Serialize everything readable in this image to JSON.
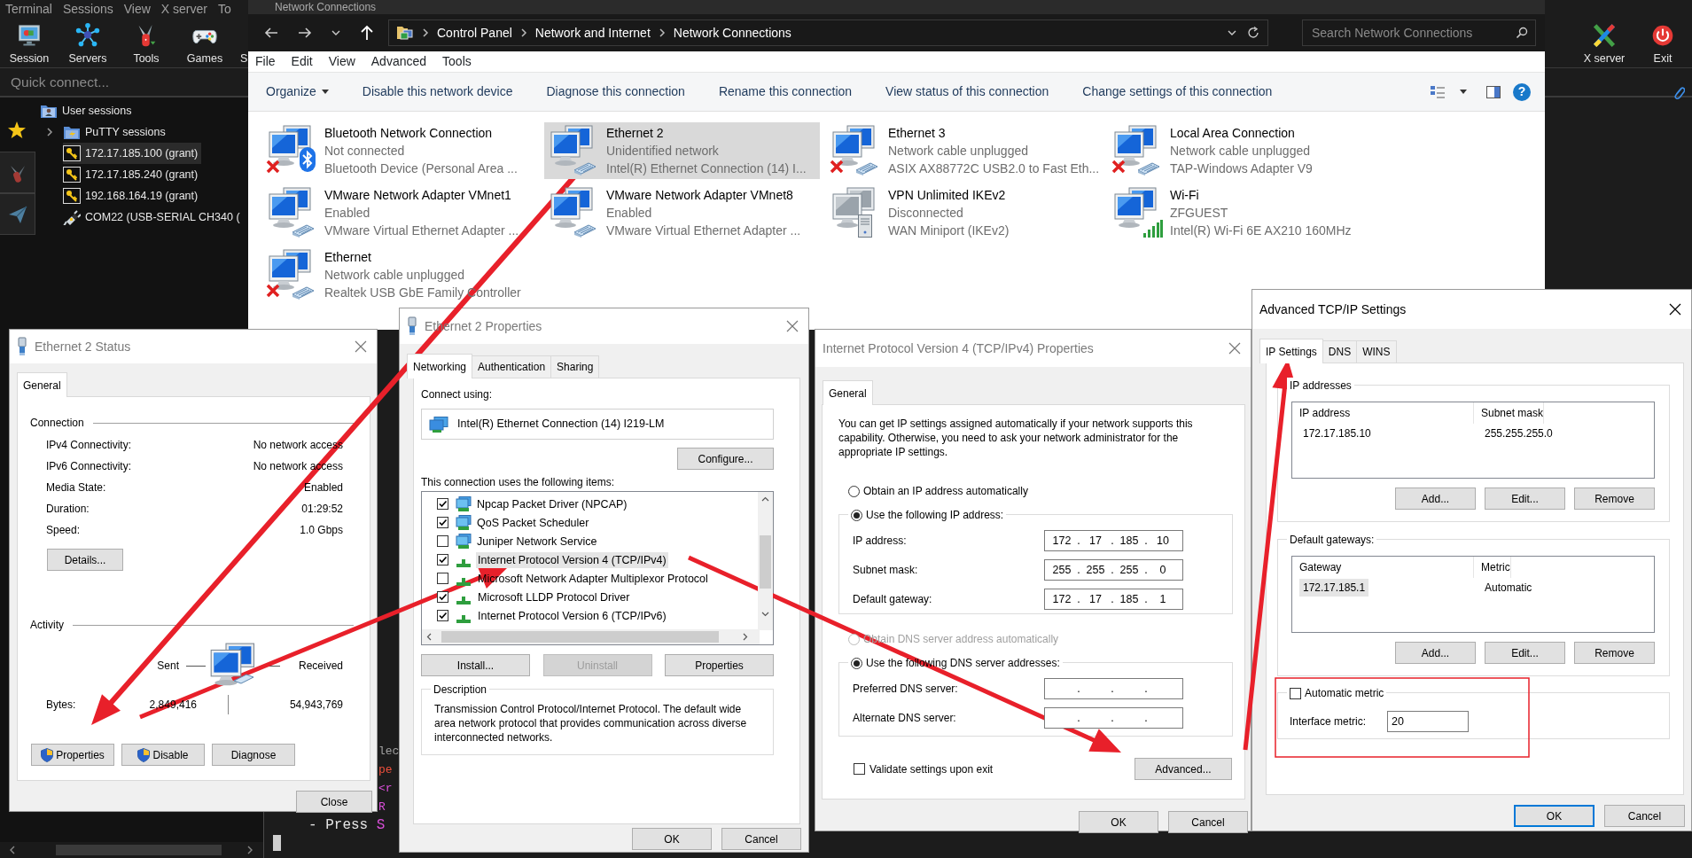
{
  "mobaxterm": {
    "menu": [
      "Terminal",
      "Sessions",
      "View",
      "X server",
      "To"
    ],
    "toolbar": [
      {
        "label": "Session",
        "kind": "session"
      },
      {
        "label": "Servers",
        "kind": "servers"
      },
      {
        "label": "Tools",
        "kind": "tools"
      },
      {
        "label": "Games",
        "kind": "games"
      },
      {
        "label": "S",
        "kind": "partial"
      }
    ],
    "toolbar_right": [
      {
        "label": "X server",
        "kind": "xserver"
      },
      {
        "label": "Exit",
        "kind": "exit"
      }
    ],
    "quick_connect": {
      "placeholder": "Quick connect..."
    },
    "side_tabs": [
      {
        "kind": "star",
        "selected": true
      },
      {
        "kind": "tools",
        "selected": false
      },
      {
        "kind": "send",
        "selected": false
      }
    ],
    "tree": [
      {
        "label": "User sessions",
        "kind": "user-folder",
        "selected": false,
        "children": [
          {
            "label": "PuTTY sessions",
            "kind": "folder",
            "expanded": false,
            "selected": false
          },
          {
            "label": "172.17.185.100 (grant)",
            "kind": "ssh",
            "selected": true
          },
          {
            "label": "172.17.185.240 (grant)",
            "kind": "ssh",
            "selected": false
          },
          {
            "label": "192.168.164.19 (grant)",
            "kind": "ssh",
            "selected": false
          },
          {
            "label": "COM22  (USB-SERIAL CH340 (",
            "kind": "serial",
            "selected": false
          }
        ]
      }
    ],
    "terminal_lines": [
      {
        "kind": "partial",
        "segments": [
          {
            "text": "lec",
            "color": "#a0a0a0"
          }
        ]
      },
      {
        "kind": "partial",
        "segments": [
          {
            "text": "pe",
            "color": "#f0503c"
          }
        ]
      },
      {
        "kind": "partial",
        "segments": [
          {
            "text": "<r",
            "color": "#d94fd9"
          }
        ]
      },
      {
        "kind": "partial",
        "segments": [
          {
            "text": "R",
            "color": "#d94fd9"
          }
        ]
      },
      {
        "kind": "full",
        "segments": [
          {
            "text": "- Press ",
            "color": "#e6e6e6"
          },
          {
            "text": "S",
            "color": "#d94fd9"
          }
        ]
      }
    ]
  },
  "explorer": {
    "title": "Network Connections",
    "breadcrumb": [
      "Control Panel",
      "Network and Internet",
      "Network Connections"
    ],
    "search": {
      "placeholder": "Search Network Connections"
    },
    "menu": [
      "File",
      "Edit",
      "View",
      "Advanced",
      "Tools"
    ],
    "commands": [
      {
        "label": "Organize",
        "kind": "dropdown"
      },
      {
        "label": "Disable this network device",
        "kind": "command"
      },
      {
        "label": "Diagnose this connection",
        "kind": "command"
      },
      {
        "label": "Rename this connection",
        "kind": "command"
      },
      {
        "label": "View status of this connection",
        "kind": "command"
      },
      {
        "label": "Change settings of this connection",
        "kind": "command"
      }
    ],
    "help": "?",
    "connections": [
      {
        "name": "Bluetooth Network Connection",
        "status": "Not connected",
        "device": "Bluetooth Device (Personal Area ...",
        "kind": "bluetooth",
        "error": true,
        "selected": false
      },
      {
        "name": "Ethernet 2",
        "status": "Unidentified network",
        "device": "Intel(R) Ethernet Connection (14) I...",
        "kind": "cable",
        "error": false,
        "selected": true
      },
      {
        "name": "Ethernet 3",
        "status": "Network cable unplugged",
        "device": "ASIX AX88772C USB2.0 to Fast Eth...",
        "kind": "cable",
        "error": true,
        "selected": false
      },
      {
        "name": "Local Area Connection",
        "status": "Network cable unplugged",
        "device": "TAP-Windows Adapter V9",
        "kind": "cable",
        "error": true,
        "selected": false
      },
      {
        "name": "VMware Network Adapter VMnet1",
        "status": "Enabled",
        "device": "VMware Virtual Ethernet Adapter ...",
        "kind": "cable",
        "error": false,
        "selected": false
      },
      {
        "name": "VMware Network Adapter VMnet8",
        "status": "Enabled",
        "device": "VMware Virtual Ethernet Adapter ...",
        "kind": "cable",
        "error": false,
        "selected": false
      },
      {
        "name": "VPN Unlimited IKEv2",
        "status": "Disconnected",
        "device": "WAN Miniport (IKEv2)",
        "kind": "vpn",
        "error": false,
        "selected": false
      },
      {
        "name": "Wi-Fi",
        "status": "ZFGUEST",
        "device": "Intel(R) Wi-Fi 6E AX210 160MHz",
        "kind": "wifi",
        "error": false,
        "selected": false
      },
      {
        "name": "Ethernet",
        "status": "Network cable unplugged",
        "device": "Realtek USB GbE Family Controller",
        "kind": "cable",
        "error": true,
        "selected": false
      }
    ]
  },
  "status_dialog": {
    "title": "Ethernet 2 Status",
    "active": false,
    "title_icon": true,
    "tabs": [
      {
        "label": "General",
        "selected": true
      }
    ],
    "connection_heading": "Connection",
    "fields": [
      {
        "label": "IPv4 Connectivity:",
        "value": "No network access"
      },
      {
        "label": "IPv6 Connectivity:",
        "value": "No network access"
      },
      {
        "label": "Media State:",
        "value": "Enabled"
      },
      {
        "label": "Duration:",
        "value": "01:29:52"
      },
      {
        "label": "Speed:",
        "value": "1.0 Gbps"
      }
    ],
    "details_button": "Details...",
    "activity_heading": "Activity",
    "sent_label": "Sent",
    "received_label": "Received",
    "bytes_label": "Bytes:",
    "bytes_sent": "2,849,416",
    "bytes_received": "54,943,769",
    "buttons": [
      {
        "label": "Properties",
        "shield": true
      },
      {
        "label": "Disable",
        "shield": true
      },
      {
        "label": "Diagnose",
        "shield": false
      }
    ],
    "close_button": "Close"
  },
  "properties_dialog": {
    "title": "Ethernet 2 Properties",
    "active": false,
    "title_icon": true,
    "tabs": [
      {
        "label": "Networking",
        "selected": true
      },
      {
        "label": "Authentication",
        "selected": false
      },
      {
        "label": "Sharing",
        "selected": false
      }
    ],
    "connect_using_label": "Connect using:",
    "adapter": "Intel(R) Ethernet Connection (14) I219-LM",
    "configure_button": "Configure...",
    "items_label": "This connection uses the following items:",
    "items": [
      {
        "label": "Npcap Packet Driver (NPCAP)",
        "checked": true,
        "kind": "service",
        "selected": false
      },
      {
        "label": "QoS Packet Scheduler",
        "checked": true,
        "kind": "service",
        "selected": false
      },
      {
        "label": "Juniper Network Service",
        "checked": false,
        "kind": "service",
        "selected": false
      },
      {
        "label": "Internet Protocol Version 4 (TCP/IPv4)",
        "checked": true,
        "kind": "protocol",
        "selected": true
      },
      {
        "label": "Microsoft Network Adapter Multiplexor Protocol",
        "checked": false,
        "kind": "protocol",
        "selected": false
      },
      {
        "label": "Microsoft LLDP Protocol Driver",
        "checked": true,
        "kind": "protocol",
        "selected": false
      },
      {
        "label": "Internet Protocol Version 6 (TCP/IPv6)",
        "checked": true,
        "kind": "protocol",
        "selected": false
      }
    ],
    "buttons": [
      {
        "label": "Install...",
        "disabled": false
      },
      {
        "label": "Uninstall",
        "disabled": true
      },
      {
        "label": "Properties",
        "disabled": false
      }
    ],
    "description_heading": "Description",
    "description": "Transmission Control Protocol/Internet Protocol. The default wide area network protocol that provides communication across diverse interconnected networks.",
    "footer_buttons": [
      "OK",
      "Cancel"
    ]
  },
  "ipv4_dialog": {
    "title": "Internet Protocol Version 4 (TCP/IPv4) Properties",
    "active": false,
    "title_icon": false,
    "tabs": [
      {
        "label": "General",
        "selected": true
      }
    ],
    "intro": "You can get IP settings assigned automatically if your network supports this capability. Otherwise, you need to ask your network administrator for the appropriate IP settings.",
    "separator": ".",
    "ip_options": [
      {
        "label": "Obtain an IP address automatically",
        "selected": false,
        "disabled": false
      },
      {
        "label": "Use the following IP address:",
        "selected": true,
        "disabled": false
      }
    ],
    "ip_fields": [
      {
        "label": "IP address:",
        "octets": [
          "172",
          "17",
          "185",
          "10"
        ]
      },
      {
        "label": "Subnet mask:",
        "octets": [
          "255",
          "255",
          "255",
          "0"
        ]
      },
      {
        "label": "Default gateway:",
        "octets": [
          "172",
          "17",
          "185",
          "1"
        ]
      }
    ],
    "dns_options": [
      {
        "label": "Obtain DNS server address automatically",
        "selected": false,
        "disabled": true
      },
      {
        "label": "Use the following DNS server addresses:",
        "selected": true,
        "disabled": false
      }
    ],
    "dns_fields": [
      {
        "label": "Preferred DNS server:",
        "empty": true
      },
      {
        "label": "Alternate DNS server:",
        "empty": true
      }
    ],
    "validate": {
      "label": "Validate settings upon exit",
      "checked": false
    },
    "advanced_button": "Advanced...",
    "footer_buttons": [
      "OK",
      "Cancel"
    ]
  },
  "advanced_dialog": {
    "title": "Advanced TCP/IP Settings",
    "active": true,
    "title_icon": false,
    "tabs": [
      {
        "label": "IP Settings",
        "selected": true
      },
      {
        "label": "DNS",
        "selected": false
      },
      {
        "label": "WINS",
        "selected": false
      }
    ],
    "groups": [
      {
        "title": "IP addresses",
        "columns": [
          "IP address",
          "Subnet mask"
        ],
        "rows": [
          {
            "cells": [
              "172.17.185.10",
              "255.255.255.0"
            ],
            "selected": false
          }
        ],
        "buttons": [
          "Add...",
          "Edit...",
          "Remove"
        ]
      },
      {
        "title": "Default gateways:",
        "columns": [
          "Gateway",
          "Metric"
        ],
        "rows": [
          {
            "cells": [
              "172.17.185.1",
              "Automatic"
            ],
            "selected": true
          }
        ],
        "buttons": [
          "Add...",
          "Edit...",
          "Remove"
        ]
      }
    ],
    "automatic_metric": {
      "label": "Automatic metric",
      "checked": false
    },
    "interface_metric": {
      "label": "Interface metric:",
      "value": "20"
    },
    "footer_buttons": [
      {
        "label": "OK",
        "default": true
      },
      {
        "label": "Cancel",
        "default": false
      }
    ]
  },
  "annotations": [
    {
      "kind": "arrow"
    },
    {
      "kind": "arrow"
    },
    {
      "kind": "arrow"
    },
    {
      "kind": "arrow"
    },
    {
      "kind": "box"
    }
  ]
}
